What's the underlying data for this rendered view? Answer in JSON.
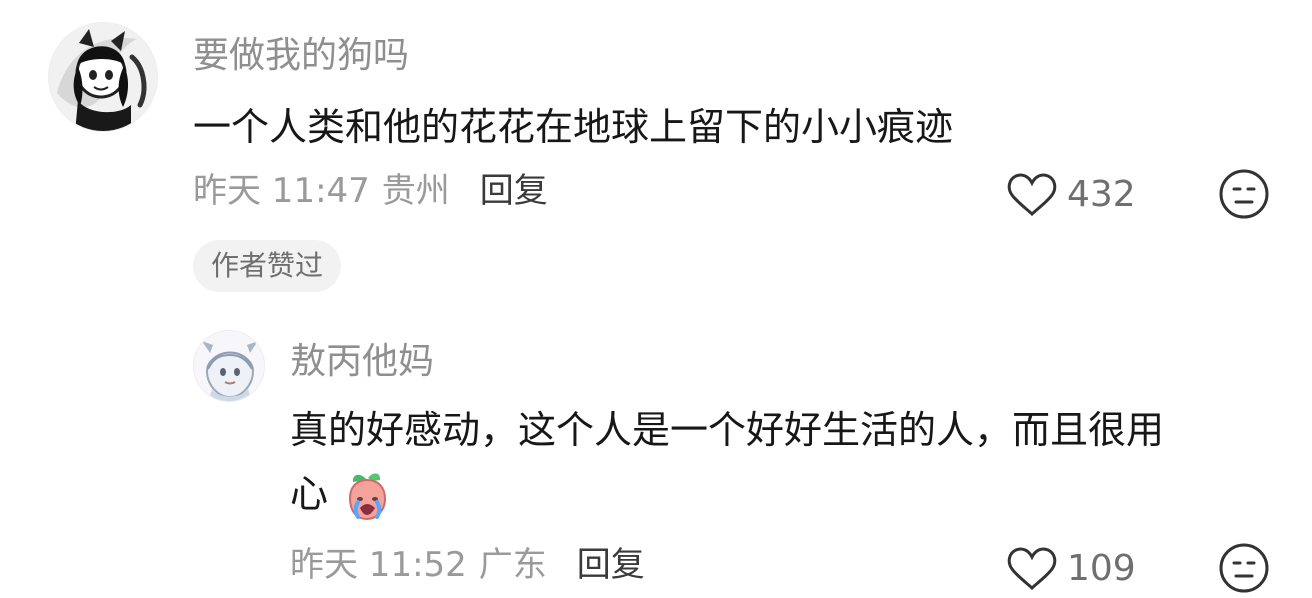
{
  "thread": {
    "main_comment": {
      "avatar_icon": "anime-cat-girl-avatar",
      "username": "要做我的狗吗",
      "content": "一个人类和他的花花在地球上留下的小小痕迹",
      "time": "昨天 11:47",
      "location": "贵州",
      "reply_label": "回复",
      "like_count": "432",
      "author_liked_badge": "作者赞过",
      "heart_icon": "heart-outline-icon",
      "emoji_icon": "emoji-neutral-icon"
    },
    "reply_comment": {
      "avatar_icon": "white-haired-character-avatar",
      "username": "敖丙他妈",
      "content_line_1": "真的好感动，这个人是一个好好生活的人，而且很用",
      "content_line_2": "心",
      "sticker_icon": "crying-peach-emoji",
      "time": "昨天 11:52",
      "location": "广东",
      "reply_label": "回复",
      "like_count": "109",
      "heart_icon": "heart-outline-icon",
      "emoji_icon": "emoji-neutral-icon"
    }
  }
}
